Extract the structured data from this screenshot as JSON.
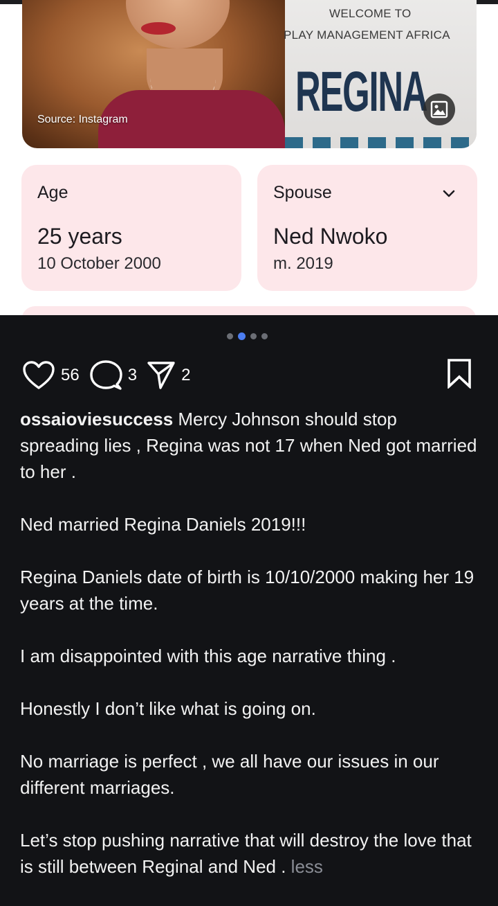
{
  "image_card": {
    "banner_line1": "WELCOME TO",
    "banner_line2": "PLAY MANAGEMENT AFRICA",
    "banner_name": "REGINA",
    "source_label": "Source: Instagram"
  },
  "info_cards": {
    "age": {
      "label": "Age",
      "value": "25 years",
      "sub": "10 October 2000"
    },
    "spouse": {
      "label": "Spouse",
      "value": "Ned Nwoko",
      "sub": "m. 2019"
    }
  },
  "carousel": {
    "total": 4,
    "active_index": 1
  },
  "actions": {
    "likes": "56",
    "comments": "3",
    "shares": "2"
  },
  "caption": {
    "username": "ossaioviesuccess",
    "first_line": " Mercy Johnson should stop spreading lies , Regina was not 17 when Ned got married to her .",
    "paragraphs": [
      "Ned married Regina Daniels 2019!!!",
      "Regina Daniels date of birth is 10/10/2000 making her 19 years at the time.",
      "I am disappointed with this age narrative thing .",
      "Honestly I don’t like what is going on.",
      "No marriage is perfect , we all have our issues in our different marriages."
    ],
    "last_paragraph": "Let’s stop pushing narrative that will destroy the love that is still between Reginal and Ned . ",
    "less_label": "less"
  },
  "colors": {
    "card_bg": "#fde7ea",
    "dark_bg": "#121316",
    "active_dot": "#4c7df0"
  },
  "icons": [
    "heart-icon",
    "comment-icon",
    "share-icon",
    "bookmark-icon",
    "chevron-down-icon",
    "image-icon"
  ]
}
